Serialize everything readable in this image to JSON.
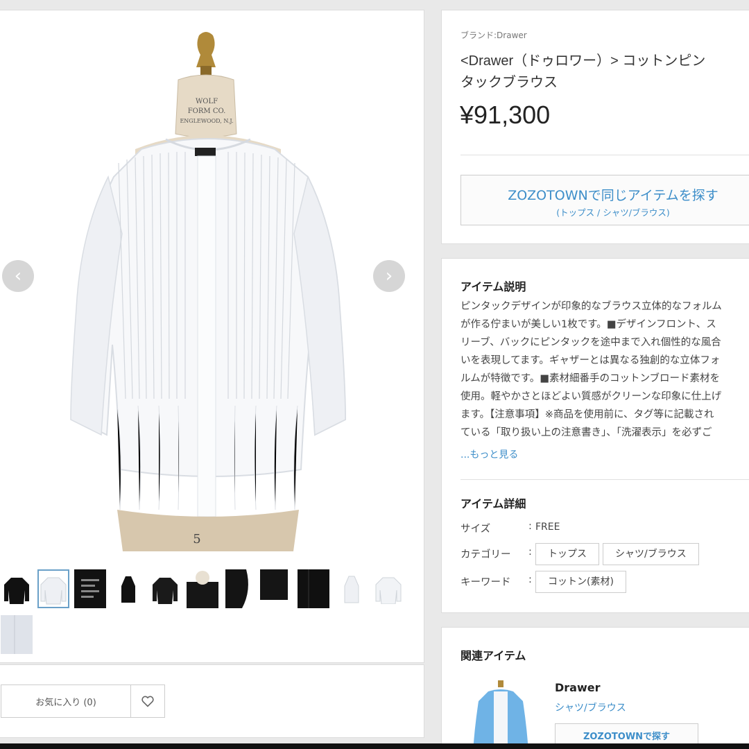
{
  "brand_label": "ブランド:Drawer",
  "product": {
    "title_line1": "<Drawer（ドゥロワー）> コットンピン",
    "title_line2": "タックブラウス",
    "price": "¥91,300"
  },
  "zozo_search": {
    "label": "ZOZOTOWNで同じアイテムを探す",
    "sub": "(トップス / シャツ/ブラウス)"
  },
  "mannequin_label": {
    "line1": "WOLF",
    "line2": "FORM CO.",
    "line3": "ENGLEWOOD, N.J.",
    "size_number": "5"
  },
  "favorite": {
    "label": "お気に入り (0)",
    "icon": "heart-icon"
  },
  "navigation": {
    "prev_icon": "chevron-left-icon",
    "next_icon": "chevron-right-icon"
  },
  "thumbnails": [
    {
      "kind": "black-blouse-front"
    },
    {
      "kind": "white-blouse-front",
      "selected": true
    },
    {
      "kind": "label-closeup"
    },
    {
      "kind": "black-blouse-side"
    },
    {
      "kind": "black-blouse-back"
    },
    {
      "kind": "black-detail"
    },
    {
      "kind": "black-sleeve"
    },
    {
      "kind": "black-hem"
    },
    {
      "kind": "black-fabric"
    },
    {
      "kind": "white-blouse-side"
    },
    {
      "kind": "white-blouse-back"
    },
    {
      "kind": "white-fabric"
    }
  ],
  "description": {
    "heading": "アイテム説明",
    "lines": [
      "ピンタックデザインが印象的なブラウス立体的なフォルム",
      "が作る佇まいが美しい1枚です。■デザインフロント、ス",
      "リーブ、バックにピンタックを途中まで入れ個性的な風合",
      "いを表現してます。ギャザーとは異なる独創的な立体フォ",
      "ルムが特徴です。■素材細番手のコットンブロード素材を",
      "使用。軽やかさとほどよい質感がクリーンな印象に仕上げ",
      "ます。【注意事項】※商品を使用前に、タグ等に記載され",
      "ている「取り扱い上の注意書き」、「洗濯表示」を必ずご"
    ],
    "more_link": "...もっと見る"
  },
  "details": {
    "heading": "アイテム詳細",
    "size_label": "サイズ",
    "size_value": "FREE",
    "category_label": "カテゴリー",
    "category_tags": [
      "トップス",
      "シャツ/ブラウス"
    ],
    "keyword_label": "キーワード",
    "keyword_tags": [
      "コットン(素材)"
    ],
    "colon": ":"
  },
  "related": {
    "heading": "関連アイテム",
    "brand": "Drawer",
    "category": "シャツ/ブラウス",
    "button_label": "ZOZOTOWNで探す"
  },
  "colors": {
    "link_blue": "#3d8ec9",
    "panel_border": "#dcdcdc",
    "background": "#e9e9e9"
  }
}
